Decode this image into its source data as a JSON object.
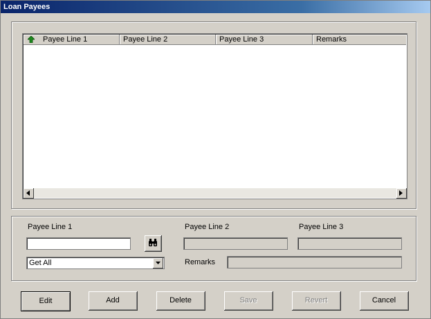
{
  "window": {
    "title": "Loan Payees"
  },
  "list": {
    "columns": [
      "Payee Line 1",
      "Payee Line 2",
      "Payee Line 3",
      "Remarks"
    ]
  },
  "form": {
    "payee_line1_label": "Payee Line 1",
    "payee_line2_label": "Payee Line 2",
    "payee_line3_label": "Payee Line 3",
    "remarks_label": "Remarks",
    "payee_line1_value": "",
    "payee_line2_value": "",
    "payee_line3_value": "",
    "remarks_value": "",
    "filter_selected": "Get All"
  },
  "buttons": {
    "edit": "Edit",
    "add": "Add",
    "delete": "Delete",
    "save": "Save",
    "revert": "Revert",
    "cancel": "Cancel"
  },
  "icons": {
    "sort": "sort-ascending-icon",
    "find": "binoculars-icon"
  },
  "colors": {
    "titlebar_start": "#0a246a",
    "titlebar_end": "#a6caf0",
    "sort_arrow": "#1d8a1d"
  }
}
